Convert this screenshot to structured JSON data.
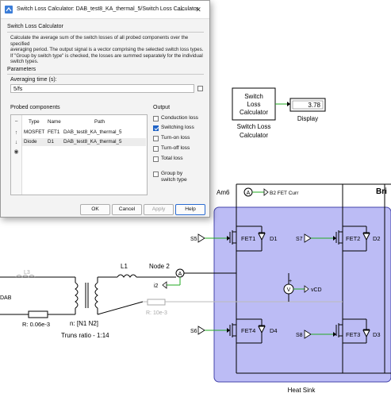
{
  "dialog": {
    "title": "Switch Loss Calculator: DAB_test8_KA_thermal_5/Switch Loss Calculator",
    "window_controls": {
      "minimize": "—",
      "close": "✕"
    },
    "section_header": "Switch Loss Calculator",
    "description_lines": [
      "Calculate the average sum of the switch losses of all probed components over the specified",
      "averaging period. The output signal is a vector comprising the selected switch loss types.",
      "If \"Group by switch type\" is checked, the losses are summed separately for the individual",
      "switch types."
    ],
    "parameters_label": "Parameters",
    "averaging_label": "Averaging time (s):",
    "averaging_value": "5/fs",
    "probed_label": "Probed components",
    "table": {
      "headers": [
        "Type",
        "Name",
        "Path"
      ],
      "rows": [
        {
          "type": "MOSFET",
          "name": "FET1",
          "path": "DAB_test8_KA_thermal_5"
        },
        {
          "type": "Diode",
          "name": "D1",
          "path": "DAB_test8_KA_thermal_5"
        }
      ]
    },
    "tools": [
      "−",
      "↑",
      "↓",
      "◉"
    ],
    "output": {
      "label": "Output",
      "options": [
        {
          "label": "Conduction loss",
          "checked": false
        },
        {
          "label": "Switching loss",
          "checked": true
        },
        {
          "label": "Turn-on loss",
          "checked": false
        },
        {
          "label": "Turn-off loss",
          "checked": false
        },
        {
          "label": "Total loss",
          "checked": false
        }
      ],
      "group_label_1": "Group by",
      "group_label_2": "switch type",
      "group_checked": false
    },
    "buttons": {
      "ok": "OK",
      "cancel": "Cancel",
      "apply": "Apply",
      "help": "Help"
    }
  },
  "schematic": {
    "calc_block_lines": [
      "Switch",
      "Loss",
      "Calculator"
    ],
    "calc_caption_1": "Switch Loss",
    "calc_caption_2": "Calculator",
    "display_value": "3.78",
    "display_label": "Display",
    "title_partial": "Bri",
    "am6_label": "Am6",
    "ammeter_symbol": "A",
    "voltmeter_symbol": "V",
    "b2_label": "B2 FET Curr",
    "s5": "S5",
    "s6": "S6",
    "s7": "S7",
    "s8": "S8",
    "fet1": "FET1",
    "fet2": "FET2",
    "fet3": "FET3",
    "fet4": "FET4",
    "d1": "D1",
    "d2": "D2",
    "d3": "D3",
    "d4": "D4",
    "l1": "L1",
    "l3": "L3",
    "node2": "Node 2",
    "i2": "i2",
    "vcd": "vCD",
    "plus": "+",
    "dab_label": "DAB",
    "r_label": "R: 0.06e-3",
    "r2_label": "R: 10e-3",
    "n_label": "n: [N1 N2]",
    "turns_label": "Truns ratio - 1:14",
    "heatsink_label": "Heat Sink",
    "heatsink_color": "#bcbcf5",
    "wire_green": "#22aa22"
  }
}
